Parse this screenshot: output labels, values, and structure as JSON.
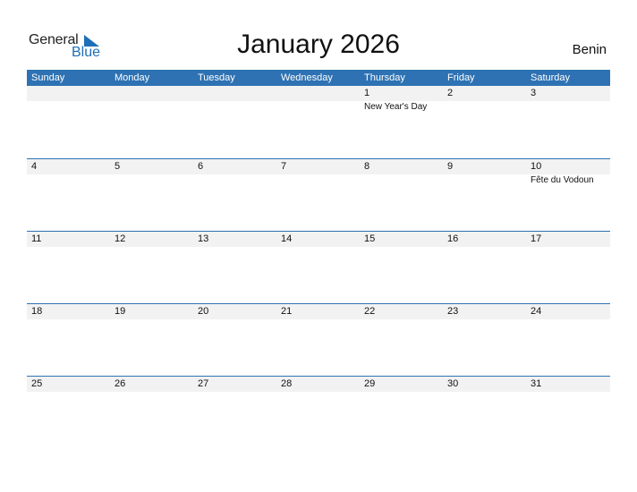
{
  "logo": {
    "line1": "General",
    "line2": "Blue"
  },
  "title": "January 2026",
  "country": "Benin",
  "weekdays": [
    "Sunday",
    "Monday",
    "Tuesday",
    "Wednesday",
    "Thursday",
    "Friday",
    "Saturday"
  ],
  "weeks": [
    {
      "days": [
        "",
        "",
        "",
        "",
        "1",
        "2",
        "3"
      ],
      "events": [
        "",
        "",
        "",
        "",
        "New Year's Day",
        "",
        ""
      ]
    },
    {
      "days": [
        "4",
        "5",
        "6",
        "7",
        "8",
        "9",
        "10"
      ],
      "events": [
        "",
        "",
        "",
        "",
        "",
        "",
        "Fête du Vodoun"
      ]
    },
    {
      "days": [
        "11",
        "12",
        "13",
        "14",
        "15",
        "16",
        "17"
      ],
      "events": [
        "",
        "",
        "",
        "",
        "",
        "",
        ""
      ]
    },
    {
      "days": [
        "18",
        "19",
        "20",
        "21",
        "22",
        "23",
        "24"
      ],
      "events": [
        "",
        "",
        "",
        "",
        "",
        "",
        ""
      ]
    },
    {
      "days": [
        "25",
        "26",
        "27",
        "28",
        "29",
        "30",
        "31"
      ],
      "events": [
        "",
        "",
        "",
        "",
        "",
        "",
        ""
      ]
    }
  ]
}
